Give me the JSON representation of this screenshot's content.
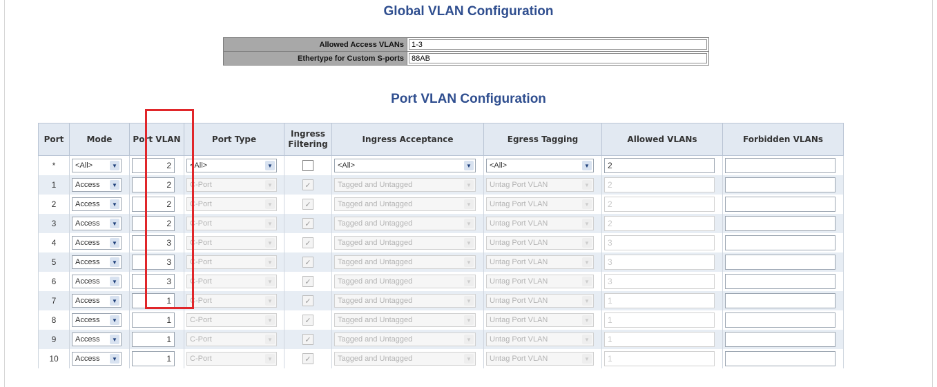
{
  "global": {
    "title": "Global VLAN Configuration",
    "rows": [
      {
        "label": "Allowed Access VLANs",
        "value": "1-3"
      },
      {
        "label": "Ethertype for Custom S-ports",
        "value": "88AB"
      }
    ]
  },
  "port": {
    "title": "Port VLAN Configuration",
    "headers": {
      "port": "Port",
      "mode": "Mode",
      "port_vlan": "Port VLAN",
      "port_type": "Port Type",
      "ingress_filtering": "Ingress Filtering",
      "ingress_acceptance": "Ingress Acceptance",
      "egress_tagging": "Egress Tagging",
      "allowed_vlans": "Allowed VLANs",
      "forbidden_vlans": "Forbidden VLANs"
    },
    "all_row": {
      "port": "*",
      "mode": "<All>",
      "port_vlan": "2",
      "port_type": "<All>",
      "ingress_acceptance": "<All>",
      "egress_tagging": "<All>",
      "allowed_vlans": "2",
      "forbidden_vlans": ""
    },
    "rows": [
      {
        "port": "1",
        "mode": "Access",
        "port_vlan": "2",
        "port_type": "C-Port",
        "ingress_acceptance": "Tagged and Untagged",
        "egress_tagging": "Untag Port VLAN",
        "allowed_vlans": "2",
        "forbidden_vlans": ""
      },
      {
        "port": "2",
        "mode": "Access",
        "port_vlan": "2",
        "port_type": "C-Port",
        "ingress_acceptance": "Tagged and Untagged",
        "egress_tagging": "Untag Port VLAN",
        "allowed_vlans": "2",
        "forbidden_vlans": ""
      },
      {
        "port": "3",
        "mode": "Access",
        "port_vlan": "2",
        "port_type": "C-Port",
        "ingress_acceptance": "Tagged and Untagged",
        "egress_tagging": "Untag Port VLAN",
        "allowed_vlans": "2",
        "forbidden_vlans": ""
      },
      {
        "port": "4",
        "mode": "Access",
        "port_vlan": "3",
        "port_type": "C-Port",
        "ingress_acceptance": "Tagged and Untagged",
        "egress_tagging": "Untag Port VLAN",
        "allowed_vlans": "3",
        "forbidden_vlans": ""
      },
      {
        "port": "5",
        "mode": "Access",
        "port_vlan": "3",
        "port_type": "C-Port",
        "ingress_acceptance": "Tagged and Untagged",
        "egress_tagging": "Untag Port VLAN",
        "allowed_vlans": "3",
        "forbidden_vlans": ""
      },
      {
        "port": "6",
        "mode": "Access",
        "port_vlan": "3",
        "port_type": "C-Port",
        "ingress_acceptance": "Tagged and Untagged",
        "egress_tagging": "Untag Port VLAN",
        "allowed_vlans": "3",
        "forbidden_vlans": ""
      },
      {
        "port": "7",
        "mode": "Access",
        "port_vlan": "1",
        "port_type": "C-Port",
        "ingress_acceptance": "Tagged and Untagged",
        "egress_tagging": "Untag Port VLAN",
        "allowed_vlans": "1",
        "forbidden_vlans": ""
      },
      {
        "port": "8",
        "mode": "Access",
        "port_vlan": "1",
        "port_type": "C-Port",
        "ingress_acceptance": "Tagged and Untagged",
        "egress_tagging": "Untag Port VLAN",
        "allowed_vlans": "1",
        "forbidden_vlans": ""
      },
      {
        "port": "9",
        "mode": "Access",
        "port_vlan": "1",
        "port_type": "C-Port",
        "ingress_acceptance": "Tagged and Untagged",
        "egress_tagging": "Untag Port VLAN",
        "allowed_vlans": "1",
        "forbidden_vlans": ""
      },
      {
        "port": "10",
        "mode": "Access",
        "port_vlan": "1",
        "port_type": "C-Port",
        "ingress_acceptance": "Tagged and Untagged",
        "egress_tagging": "Untag Port VLAN",
        "allowed_vlans": "1",
        "forbidden_vlans": ""
      }
    ]
  },
  "colors": {
    "title": "#2f4e8f",
    "header_bg": "#e2e9f2",
    "alt_row": "#e7edf4",
    "highlight": "#e0262a"
  },
  "icons": {
    "dropdown": "chevron-down-icon",
    "checkbox": "checkbox-icon"
  }
}
